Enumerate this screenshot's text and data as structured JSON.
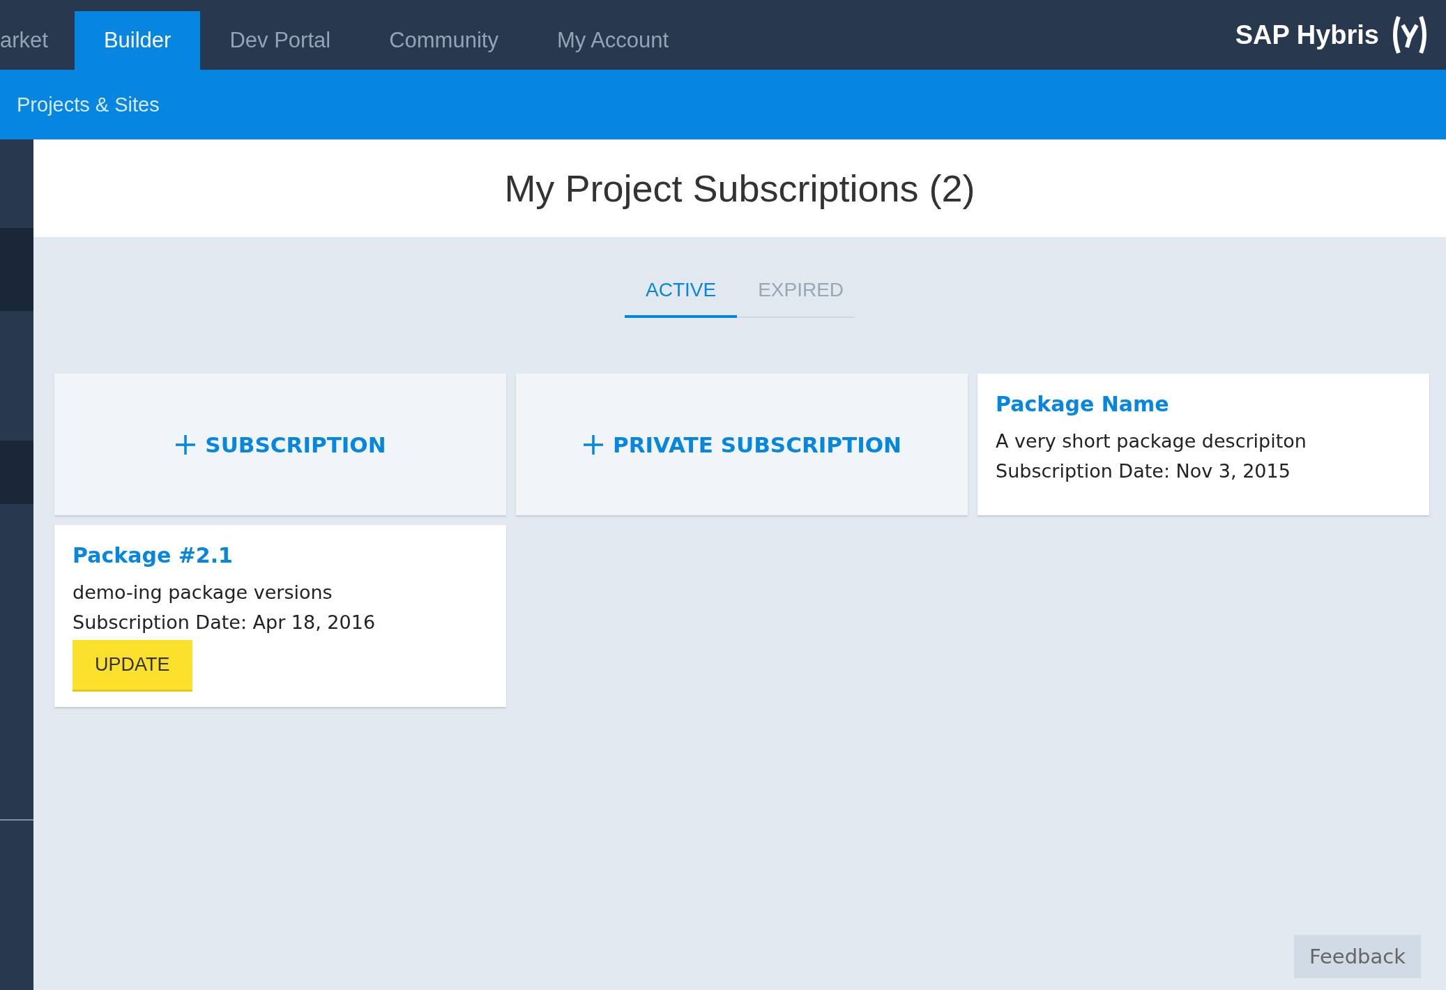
{
  "top_nav": {
    "tabs": [
      {
        "label": "arket",
        "selected": false
      },
      {
        "label": "Builder",
        "selected": true
      },
      {
        "label": "Dev Portal",
        "selected": false
      },
      {
        "label": "Community",
        "selected": false
      },
      {
        "label": "My Account",
        "selected": false
      }
    ],
    "brand": "SAP Hybris"
  },
  "sub_nav": {
    "link": "Projects & Sites"
  },
  "page_title": "My Project Subscriptions (2)",
  "tabs": [
    {
      "label": "ACTIVE",
      "selected": true
    },
    {
      "label": "EXPIRED",
      "selected": false
    }
  ],
  "cards": [
    {
      "kind": "add",
      "label": "SUBSCRIPTION"
    },
    {
      "kind": "add",
      "label": "PRIVATE SUBSCRIPTION"
    },
    {
      "kind": "package",
      "name": "Package Name",
      "description": "A very short package descripiton",
      "date": "Subscription Date: Nov 3, 2015"
    },
    {
      "kind": "package",
      "name": "Package #2.1",
      "description": "demo-ing package versions",
      "date": "Subscription Date: Apr 18, 2016",
      "button": "UPDATE"
    }
  ],
  "feedback": "Feedback"
}
